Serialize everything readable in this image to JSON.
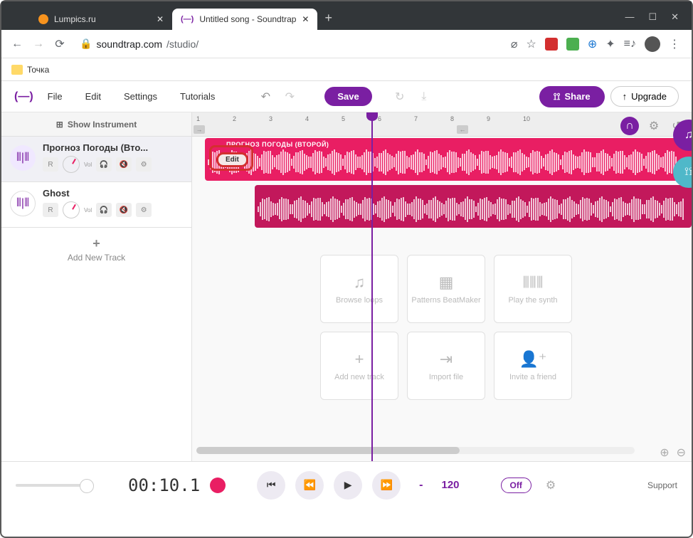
{
  "browser": {
    "tabs": [
      {
        "title": "Lumpics.ru",
        "favicon_color": "#f7931e"
      },
      {
        "title": "Untitled song - Soundtrap",
        "favicon_text": "(—)",
        "favicon_color": "#7a1fa2"
      }
    ],
    "url_host": "soundtrap.com",
    "url_path": "/studio/",
    "bookmark": "Точка"
  },
  "header": {
    "menu": [
      "File",
      "Edit",
      "Settings",
      "Tutorials"
    ],
    "save": "Save",
    "share": "Share",
    "upgrade": "Upgrade"
  },
  "sidebar": {
    "show_instrument": "Show Instrument",
    "tracks": [
      {
        "name": "Прогноз Погоды (Вто...",
        "rec": "R",
        "vol": "Vol"
      },
      {
        "name": "Ghost",
        "rec": "R",
        "vol": "Vol"
      }
    ],
    "add_track": "Add New Track"
  },
  "timeline": {
    "marks": [
      "1",
      "2",
      "3",
      "4",
      "5",
      "6",
      "7",
      "8",
      "9",
      "10"
    ],
    "clip1_title": "ПРОГНОЗ ПОГОДЫ (ВТОРОЙ)",
    "edit_label": "Edit"
  },
  "hints": [
    {
      "icon": "♫",
      "label": "Browse loops"
    },
    {
      "icon": "▦",
      "label": "Patterns BeatMaker"
    },
    {
      "icon": "⦀⦀⦀",
      "label": "Play the synth"
    },
    {
      "icon": "+",
      "label": "Add new track"
    },
    {
      "icon": "⇥",
      "label": "Import file"
    },
    {
      "icon": "👤⁺",
      "label": "Invite a friend"
    }
  ],
  "transport": {
    "time": "00:10.1",
    "dash": "-",
    "bpm": "120",
    "off": "Off",
    "support": "Support"
  }
}
